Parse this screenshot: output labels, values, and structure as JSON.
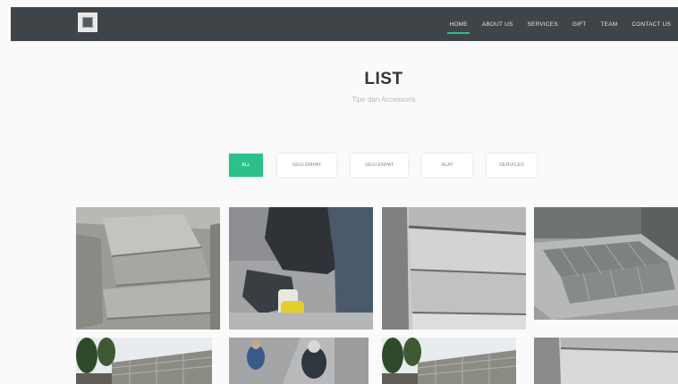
{
  "nav": {
    "items": [
      "HOME",
      "ABOUT US",
      "SERVICES",
      "GIFT",
      "TEAM",
      "CONTACT US"
    ],
    "active_index": 0
  },
  "header": {
    "title": "LIST",
    "subtitle": "Tipe dan Accessoris"
  },
  "filters": {
    "items": [
      "ALL",
      "SEGI EMPAT",
      "SEGI ENPAT",
      "ALAT",
      "SERVICES"
    ],
    "active_index": 0
  },
  "gallery": {
    "icons": [
      "paving-blocks-stack-photo",
      "worker-laying-blocks-photo",
      "concrete-block-closeup-photo",
      "block-pallet-photo",
      "block-wall-outdoor-photo",
      "workers-building-wall-photo",
      "block-wall-outdoor-photo",
      "concrete-slab-photo"
    ]
  },
  "colors": {
    "navbar": "#3f4448",
    "accent": "#2cc18a"
  }
}
